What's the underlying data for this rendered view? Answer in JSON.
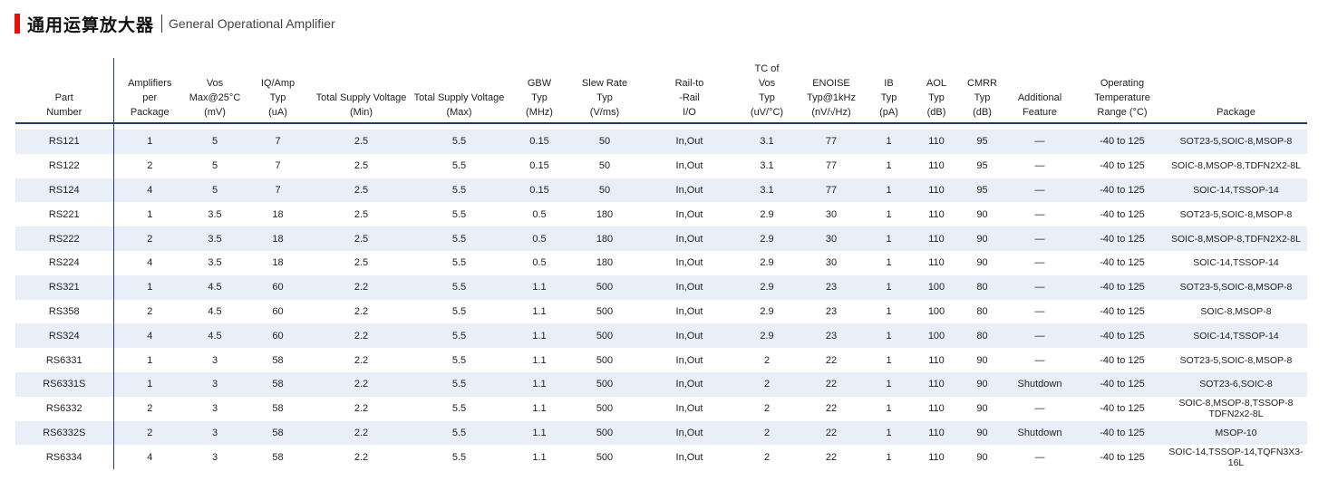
{
  "title": {
    "cn": "通用运算放大器",
    "en": "General Operational Amplifier"
  },
  "colors": {
    "accent": "#e3120b",
    "rule": "#1f3c7a",
    "stripe": "#e9eff8"
  },
  "table": {
    "headers": [
      "Part\nNumber",
      "Amplifiers\nper\nPackage",
      "Vos\nMax@25°C\n(mV)",
      "IQ/Amp\nTyp\n(uA)",
      "Total Supply Voltage\n(Min)",
      "Total Supply Voltage\n(Max)",
      "GBW\nTyp\n(MHz)",
      "Slew Rate\nTyp\n(V/ms)",
      "Rail-to\n-Rail\nI/O",
      "TC of\nVos\nTyp\n(uV/°C)",
      "ENOISE\nTyp@1kHz\n(nV/√Hz)",
      "IB\nTyp\n(pA)",
      "AOL\nTyp\n(dB)",
      "CMRR\nTyp\n(dB)",
      "Additional\nFeature",
      "Operating\nTemperature\nRange (°C)",
      "Package"
    ],
    "rows": [
      [
        "RS121",
        "1",
        "5",
        "7",
        "2.5",
        "5.5",
        "0.15",
        "50",
        "In,Out",
        "3.1",
        "77",
        "1",
        "110",
        "95",
        "—",
        "-40 to 125",
        "SOT23-5,SOIC-8,MSOP-8"
      ],
      [
        "RS122",
        "2",
        "5",
        "7",
        "2.5",
        "5.5",
        "0.15",
        "50",
        "In,Out",
        "3.1",
        "77",
        "1",
        "110",
        "95",
        "—",
        "-40 to 125",
        "SOIC-8,MSOP-8,TDFN2X2-8L"
      ],
      [
        "RS124",
        "4",
        "5",
        "7",
        "2.5",
        "5.5",
        "0.15",
        "50",
        "In,Out",
        "3.1",
        "77",
        "1",
        "110",
        "95",
        "—",
        "-40 to 125",
        "SOIC-14,TSSOP-14"
      ],
      [
        "RS221",
        "1",
        "3.5",
        "18",
        "2.5",
        "5.5",
        "0.5",
        "180",
        "In,Out",
        "2.9",
        "30",
        "1",
        "110",
        "90",
        "—",
        "-40 to 125",
        "SOT23-5,SOIC-8,MSOP-8"
      ],
      [
        "RS222",
        "2",
        "3.5",
        "18",
        "2.5",
        "5.5",
        "0.5",
        "180",
        "In,Out",
        "2.9",
        "30",
        "1",
        "110",
        "90",
        "—",
        "-40 to 125",
        "SOIC-8,MSOP-8,TDFN2X2-8L"
      ],
      [
        "RS224",
        "4",
        "3.5",
        "18",
        "2.5",
        "5.5",
        "0.5",
        "180",
        "In,Out",
        "2.9",
        "30",
        "1",
        "110",
        "90",
        "—",
        "-40 to 125",
        "SOIC-14,TSSOP-14"
      ],
      [
        "RS321",
        "1",
        "4.5",
        "60",
        "2.2",
        "5.5",
        "1.1",
        "500",
        "In,Out",
        "2.9",
        "23",
        "1",
        "100",
        "80",
        "—",
        "-40 to 125",
        "SOT23-5,SOIC-8,MSOP-8"
      ],
      [
        "RS358",
        "2",
        "4.5",
        "60",
        "2.2",
        "5.5",
        "1.1",
        "500",
        "In,Out",
        "2.9",
        "23",
        "1",
        "100",
        "80",
        "—",
        "-40 to 125",
        "SOIC-8,MSOP-8"
      ],
      [
        "RS324",
        "4",
        "4.5",
        "60",
        "2.2",
        "5.5",
        "1.1",
        "500",
        "In,Out",
        "2.9",
        "23",
        "1",
        "100",
        "80",
        "—",
        "-40 to 125",
        "SOIC-14,TSSOP-14"
      ],
      [
        "RS6331",
        "1",
        "3",
        "58",
        "2.2",
        "5.5",
        "1.1",
        "500",
        "In,Out",
        "2",
        "22",
        "1",
        "110",
        "90",
        "—",
        "-40 to 125",
        "SOT23-5,SOIC-8,MSOP-8"
      ],
      [
        "RS6331S",
        "1",
        "3",
        "58",
        "2.2",
        "5.5",
        "1.1",
        "500",
        "In,Out",
        "2",
        "22",
        "1",
        "110",
        "90",
        "Shutdown",
        "-40 to 125",
        "SOT23-6,SOIC-8"
      ],
      [
        "RS6332",
        "2",
        "3",
        "58",
        "2.2",
        "5.5",
        "1.1",
        "500",
        "In,Out",
        "2",
        "22",
        "1",
        "110",
        "90",
        "—",
        "-40 to 125",
        "SOIC-8,MSOP-8,TSSOP-8\nTDFN2x2-8L"
      ],
      [
        "RS6332S",
        "2",
        "3",
        "58",
        "2.2",
        "5.5",
        "1.1",
        "500",
        "In,Out",
        "2",
        "22",
        "1",
        "110",
        "90",
        "Shutdown",
        "-40 to 125",
        "MSOP-10"
      ],
      [
        "RS6334",
        "4",
        "3",
        "58",
        "2.2",
        "5.5",
        "1.1",
        "500",
        "In,Out",
        "2",
        "22",
        "1",
        "110",
        "90",
        "—",
        "-40 to 125",
        "SOIC-14,TSSOP-14,TQFN3X3-16L"
      ]
    ]
  }
}
